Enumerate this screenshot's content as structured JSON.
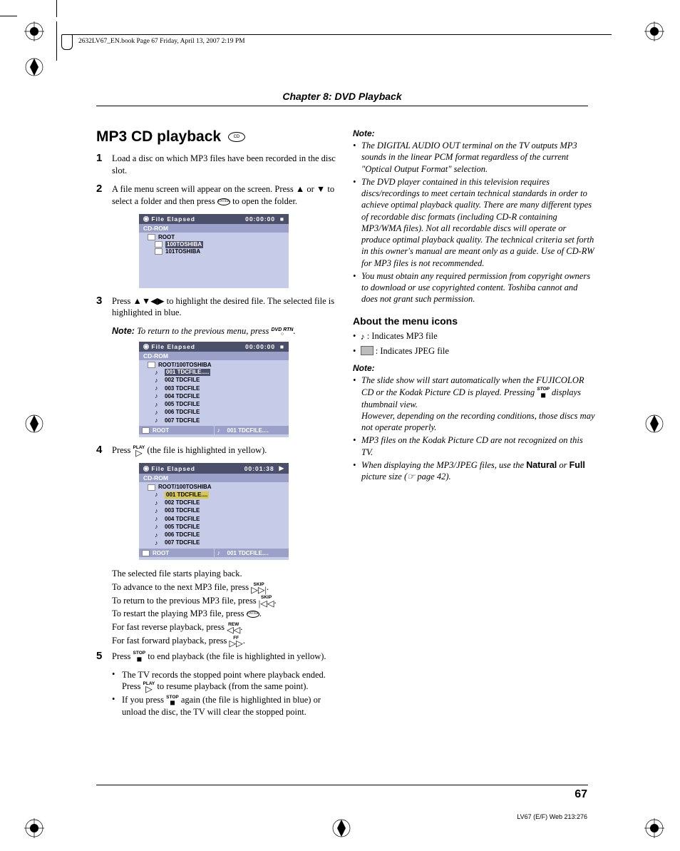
{
  "header": {
    "pageinfo": "2632LV67_EN.book  Page 67  Friday, April 13, 2007  2:19 PM"
  },
  "chapter": "Chapter 8: DVD Playback",
  "title": "MP3 CD playback",
  "title_badge": "CD",
  "steps": {
    "s1": "Load a disc on which MP3 files have been recorded in the disc slot.",
    "s2a": "A file menu screen will appear on the screen. Press ▲ or ▼ to select a folder and then press ",
    "s2b": " to open the folder.",
    "s3a": "Press ▲▼◀▶ to highlight the desired file. The selected file is highlighted in blue.",
    "note1a": "Note:",
    "note1b": " To return to the previous menu, press ",
    "s4a": "Press ",
    "s4b": " (the file is highlighted in yellow).",
    "after": [
      "The selected file starts playing back.",
      "To advance to the next MP3 file, press ",
      "To return to the previous MP3 file, press ",
      "To restart the playing MP3 file, press ",
      "For fast reverse playback, press ",
      "For fast forward playback, press "
    ],
    "s5a": "Press ",
    "s5b": " to end playback (the file is highlighted in yellow).",
    "s5_sub1a": "The TV records the stopped point where playback ended. Press ",
    "s5_sub1b": " to resume playback (from the same point).",
    "s5_sub2a": "If you press ",
    "s5_sub2b": " again (the file is highlighted in blue) or unload the disc, the TV will clear the stopped point."
  },
  "btn": {
    "enter": "ENTER",
    "dvdrtn": "DVD RTN",
    "play": "PLAY",
    "stop": "STOP",
    "skipf": "SKIP",
    "skipb": "SKIP",
    "rew": "REW",
    "ff": "FF"
  },
  "osd1": {
    "title": "File Elapsed",
    "time": "00:00:00",
    "cdrom": "CD-ROM",
    "root": "ROOT",
    "items": [
      "100TOSHIBA",
      "101TOSHIBA"
    ]
  },
  "osd2": {
    "title": "File Elapsed",
    "time": "00:00:00",
    "cdrom": "CD-ROM",
    "path": "ROOT/100TOSHIBA",
    "items": [
      "001 TDCFILE.....",
      "002 TDCFILE",
      "003 TDCFILE",
      "004 TDCFILE",
      "005 TDCFILE",
      "006 TDCFILE",
      "007 TDCFILE"
    ],
    "f1": "ROOT",
    "f2": "001 TDCFILE...."
  },
  "osd3": {
    "title": "File Elapsed",
    "time": "00:01:38",
    "cdrom": "CD-ROM",
    "path": "ROOT/100TOSHIBA",
    "items": [
      "001 TDCFILE....",
      "002 TDCFILE",
      "003 TDCFILE",
      "004 TDCFILE",
      "005 TDCFILE",
      "006 TDCFILE",
      "007 TDCFILE"
    ],
    "f1": "ROOT",
    "f2": "001 TDCFILE...."
  },
  "right": {
    "note_head": "Note:",
    "b1": "The DIGITAL AUDIO OUT terminal on the TV outputs MP3 sounds in the linear PCM format regardless of the current \"Optical Output Format\" selection.",
    "b2": "The DVD player contained in this television requires discs/recordings to meet certain technical standards in order to achieve optimal playback quality. There are many different types of recordable disc formats (including CD-R containing MP3/WMA files). Not all recordable discs will operate or produce optimal playback quality. The technical criteria set forth in this owner's manual are meant only as a guide. Use of CD-RW for MP3 files is not recommended.",
    "b3": "You must obtain any required permission from copyright owners to download or use copyrighted content. Toshiba cannot and does not grant such permission.",
    "about_h": "About the menu icons",
    "about1": ": Indicates MP3 file",
    "about2": ": Indicates JPEG file",
    "b4a": "The slide show will start automatically when the FUJICOLOR CD or the Kodak Picture CD is played. Pressing ",
    "b4b": " displays thumbnail view.",
    "b4c": "However, depending on the recording conditions, those discs may not operate properly.",
    "b5": "MP3 files on the Kodak Picture CD are not recognized on this TV.",
    "b6a": "When displaying the MP3/JPEG files, use the ",
    "b6b": "Natural",
    "b6c": " or ",
    "b6d": "Full",
    "b6e": " picture size (☞ page 42)."
  },
  "pagenum": "67",
  "footercode": "LV67 (E/F) Web 213:276"
}
